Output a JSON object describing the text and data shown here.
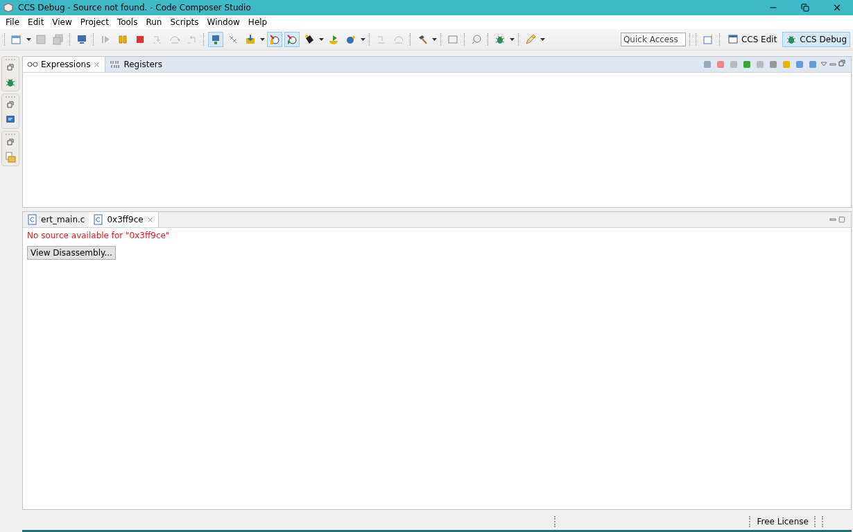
{
  "window": {
    "title": "CCS Debug - Source not found. - Code Composer Studio"
  },
  "menu": [
    "File",
    "Edit",
    "View",
    "Project",
    "Tools",
    "Run",
    "Scripts",
    "Window",
    "Help"
  ],
  "quick_access": {
    "placeholder": "Quick Access"
  },
  "perspectives": [
    {
      "label": "CCS Edit",
      "selected": false
    },
    {
      "label": "CCS Debug",
      "selected": true
    }
  ],
  "top_view": {
    "tabs": [
      {
        "label": "Expressions",
        "selected": true
      },
      {
        "label": "Registers",
        "selected": false
      }
    ]
  },
  "editor": {
    "tabs": [
      {
        "label": "ert_main.c",
        "selected": false
      },
      {
        "label": "0x3ff9ce",
        "selected": true
      }
    ],
    "message": "No source available for \"0x3ff9ce\"",
    "button": "View Disassembly..."
  },
  "status_bar": {
    "license": "Free License"
  }
}
